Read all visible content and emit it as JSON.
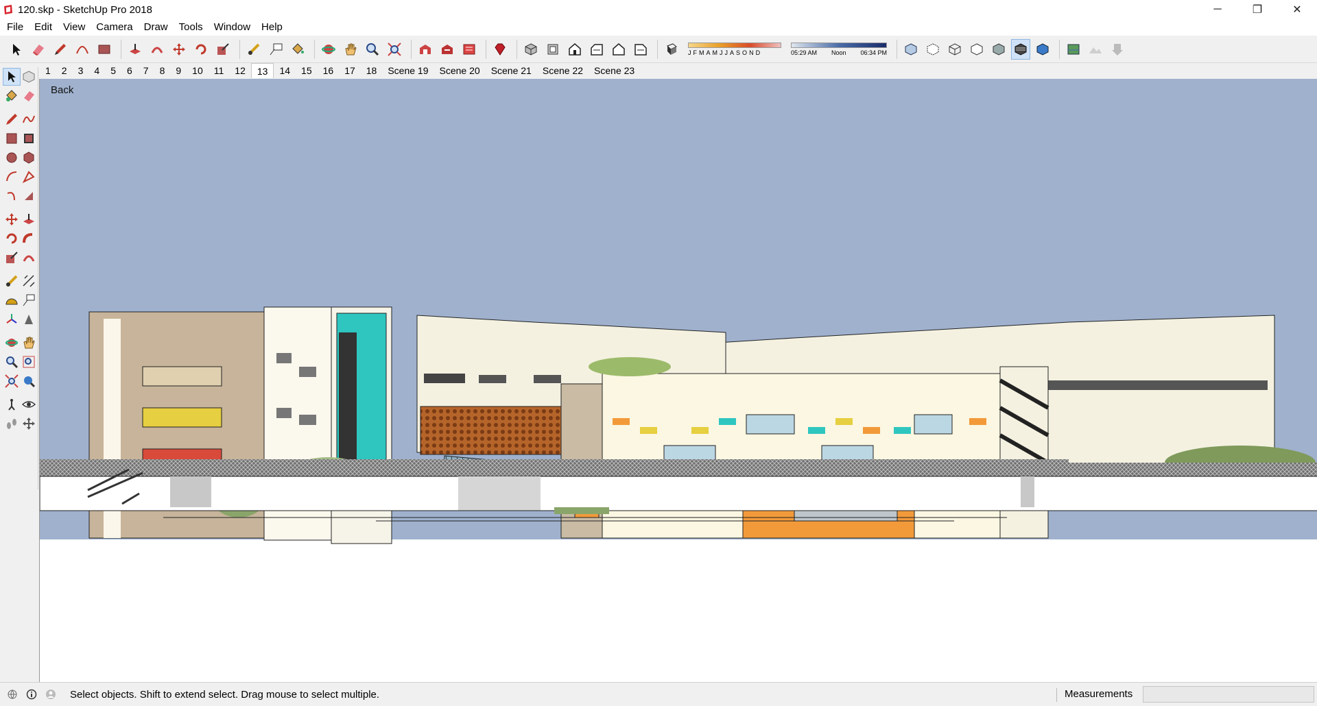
{
  "window": {
    "title": "120.skp - SketchUp Pro 2018",
    "minimize_glyph": "─",
    "restore_glyph": "❐",
    "close_glyph": "✕"
  },
  "menu": [
    "File",
    "Edit",
    "View",
    "Camera",
    "Draw",
    "Tools",
    "Window",
    "Help"
  ],
  "toolbar": {
    "months": [
      "J",
      "F",
      "M",
      "A",
      "M",
      "J",
      "J",
      "A",
      "S",
      "O",
      "N",
      "D"
    ],
    "sunrise_time": "05:29 AM",
    "noon_time": "Noon",
    "sunset_time": "06:34 PM"
  },
  "scenes": {
    "tabs": [
      "1",
      "2",
      "3",
      "4",
      "5",
      "6",
      "7",
      "8",
      "9",
      "10",
      "11",
      "12",
      "13",
      "14",
      "15",
      "16",
      "17",
      "18",
      "Scene 19",
      "Scene 20",
      "Scene 21",
      "Scene 22",
      "Scene 23"
    ],
    "active": "13"
  },
  "viewport": {
    "view_label": "Back",
    "sky_color": "#9fb1cd",
    "ground_color": "#ffffff"
  },
  "status": {
    "message": "Select objects. Shift to extend select. Drag mouse to select multiple.",
    "measurements_label": "Measurements",
    "measurements_value": ""
  },
  "colors": {
    "accent_teal": "#2fc6c0",
    "window_orange": "#f29a3a",
    "selection_highlight": "#cfe2f7"
  }
}
